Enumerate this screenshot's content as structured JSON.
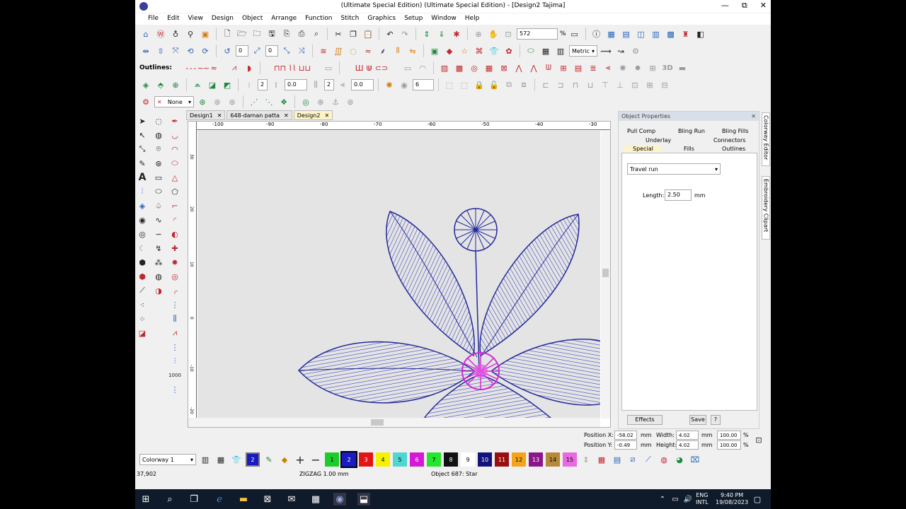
{
  "app": {
    "title": "(Ultimate Special Edition) (Ultimate Special Edition) - [Design2    Tajima]",
    "window_controls": [
      "—",
      "⧉",
      "✕"
    ]
  },
  "menu": [
    "File",
    "Edit",
    "View",
    "Design",
    "Object",
    "Arrange",
    "Function",
    "Stitch",
    "Graphics",
    "Setup",
    "Window",
    "Help"
  ],
  "toolbar1": {
    "zoom_value": "572",
    "zoom_unit": "%"
  },
  "toolbar2": {
    "field1": "0",
    "field2": "0",
    "units": "Metric"
  },
  "toolbar3": {
    "outlines_label": "Outlines:",
    "threed_label": "3D"
  },
  "toolbar4": {
    "field1": "2",
    "field2": "0.0",
    "field3": "2",
    "field4": "0.0",
    "field5": "6"
  },
  "toolbar5": {
    "none_label": "None"
  },
  "doc_tabs": [
    {
      "label": "Design1",
      "close": "✕"
    },
    {
      "label": "648-daman patta",
      "close": "✕"
    },
    {
      "label": "Design2",
      "close": "✕"
    }
  ],
  "ruler_h": [
    "-100",
    "-90",
    "-80",
    "-70",
    "-60",
    "-50",
    "-40",
    "-30"
  ],
  "ruler_v": [
    "30",
    "20",
    "10",
    "0",
    "-10",
    "-20"
  ],
  "object_properties": {
    "header": "Object Properties",
    "tabs": [
      "Pull Comp",
      "Bling Run",
      "Bling Fills",
      "Underlay",
      "Connectors",
      "Special",
      "Fills",
      "Outlines"
    ],
    "active_tab": "Special",
    "dropdown_value": "Travel run",
    "length_label": "Length:",
    "length_value": "2.50",
    "length_unit": "mm",
    "effects_button": "Effects",
    "save_button": "Save",
    "help_button": "?"
  },
  "side_tabs": [
    "Colorway Editor",
    "Embroidery Clipart"
  ],
  "position": {
    "x_label": "Position X:",
    "x_value": "-58.02",
    "x_unit": "mm",
    "y_label": "Position Y:",
    "y_value": "-0.49",
    "y_unit": "mm",
    "w_label": "Width:",
    "w_value": "4.02",
    "w_unit": "mm",
    "w_pct": "100.00",
    "w_pct_unit": "%",
    "h_label": "Height:",
    "h_value": "4.02",
    "h_unit": "mm",
    "h_pct": "100.00",
    "h_pct_unit": "%"
  },
  "colorway": {
    "label": "Colorway 1",
    "current": "2",
    "swatches": [
      {
        "n": "1",
        "color": "#1ccc2a"
      },
      {
        "n": "2",
        "color": "#1a1ac0"
      },
      {
        "n": "3",
        "color": "#e31414"
      },
      {
        "n": "4",
        "color": "#f5f100"
      },
      {
        "n": "5",
        "color": "#4fd6d0"
      },
      {
        "n": "6",
        "color": "#d41ad4"
      },
      {
        "n": "7",
        "color": "#24e62c"
      },
      {
        "n": "8",
        "color": "#111111"
      },
      {
        "n": "9",
        "color": "#ffffff"
      },
      {
        "n": "10",
        "color": "#13137a"
      },
      {
        "n": "11",
        "color": "#9a1010"
      },
      {
        "n": "12",
        "color": "#f3a41a"
      },
      {
        "n": "13",
        "color": "#8a168a"
      },
      {
        "n": "14",
        "color": "#b58a3a"
      },
      {
        "n": "15",
        "color": "#e86ae0"
      }
    ]
  },
  "status": {
    "count": "37,902",
    "stitch": "ZIGZAG  1.00 mm",
    "object": "Object 687: Star"
  },
  "taskbar": {
    "lang1": "ENG",
    "lang2": "INTL",
    "time": "9:40 PM",
    "date": "19/08/2023"
  }
}
